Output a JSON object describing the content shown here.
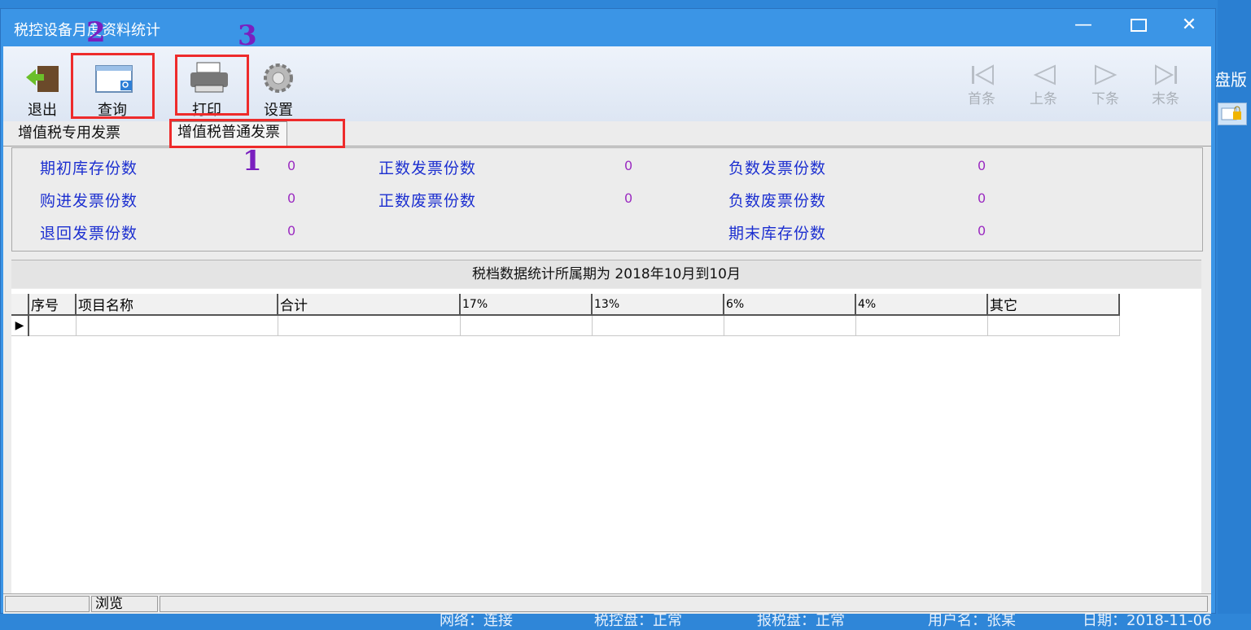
{
  "window": {
    "title": "税控设备月度资料统计"
  },
  "background": {
    "fragment": "盘版",
    "status_text": [
      "网络：连接",
      "税控盘：正常",
      "报税盘：正常",
      "用户名：张某",
      "日期：2018-11-06"
    ]
  },
  "toolbar": {
    "exit": "退出",
    "query": "查询",
    "print": "打印",
    "settings": "设置"
  },
  "nav": {
    "first": "首条",
    "prev": "上条",
    "next": "下条",
    "last": "末条"
  },
  "tabs": [
    "增值税专用发票",
    "增值税普通发票"
  ],
  "stats": {
    "opening_stock": {
      "label": "期初库存份数",
      "value": "0"
    },
    "purchased": {
      "label": "购进发票份数",
      "value": "0"
    },
    "returned": {
      "label": "退回发票份数",
      "value": "0"
    },
    "positive_invoices": {
      "label": "正数发票份数",
      "value": "0"
    },
    "positive_void": {
      "label": "正数废票份数",
      "value": "0"
    },
    "negative_invoices": {
      "label": "负数发票份数",
      "value": "0"
    },
    "negative_void": {
      "label": "负数废票份数",
      "value": "0"
    },
    "closing_stock": {
      "label": "期末库存份数",
      "value": "0"
    }
  },
  "period_text": "税档数据统计所属期为 2018年10月到10月",
  "grid": {
    "columns": [
      "序号",
      "项目名称",
      "合计",
      "17%",
      "13%",
      "6%",
      "4%",
      "其它"
    ],
    "row_indicator": "▶"
  },
  "statusbar": {
    "mode": "浏览"
  },
  "annotations": {
    "mark1": "2",
    "mark2": "3",
    "mark3": "1"
  },
  "colors": {
    "title_blue": "#3b95e6",
    "label_blue": "#1c2fd0",
    "value_purple": "#9b2bc1",
    "highlight_red": "#ee2b2b"
  }
}
